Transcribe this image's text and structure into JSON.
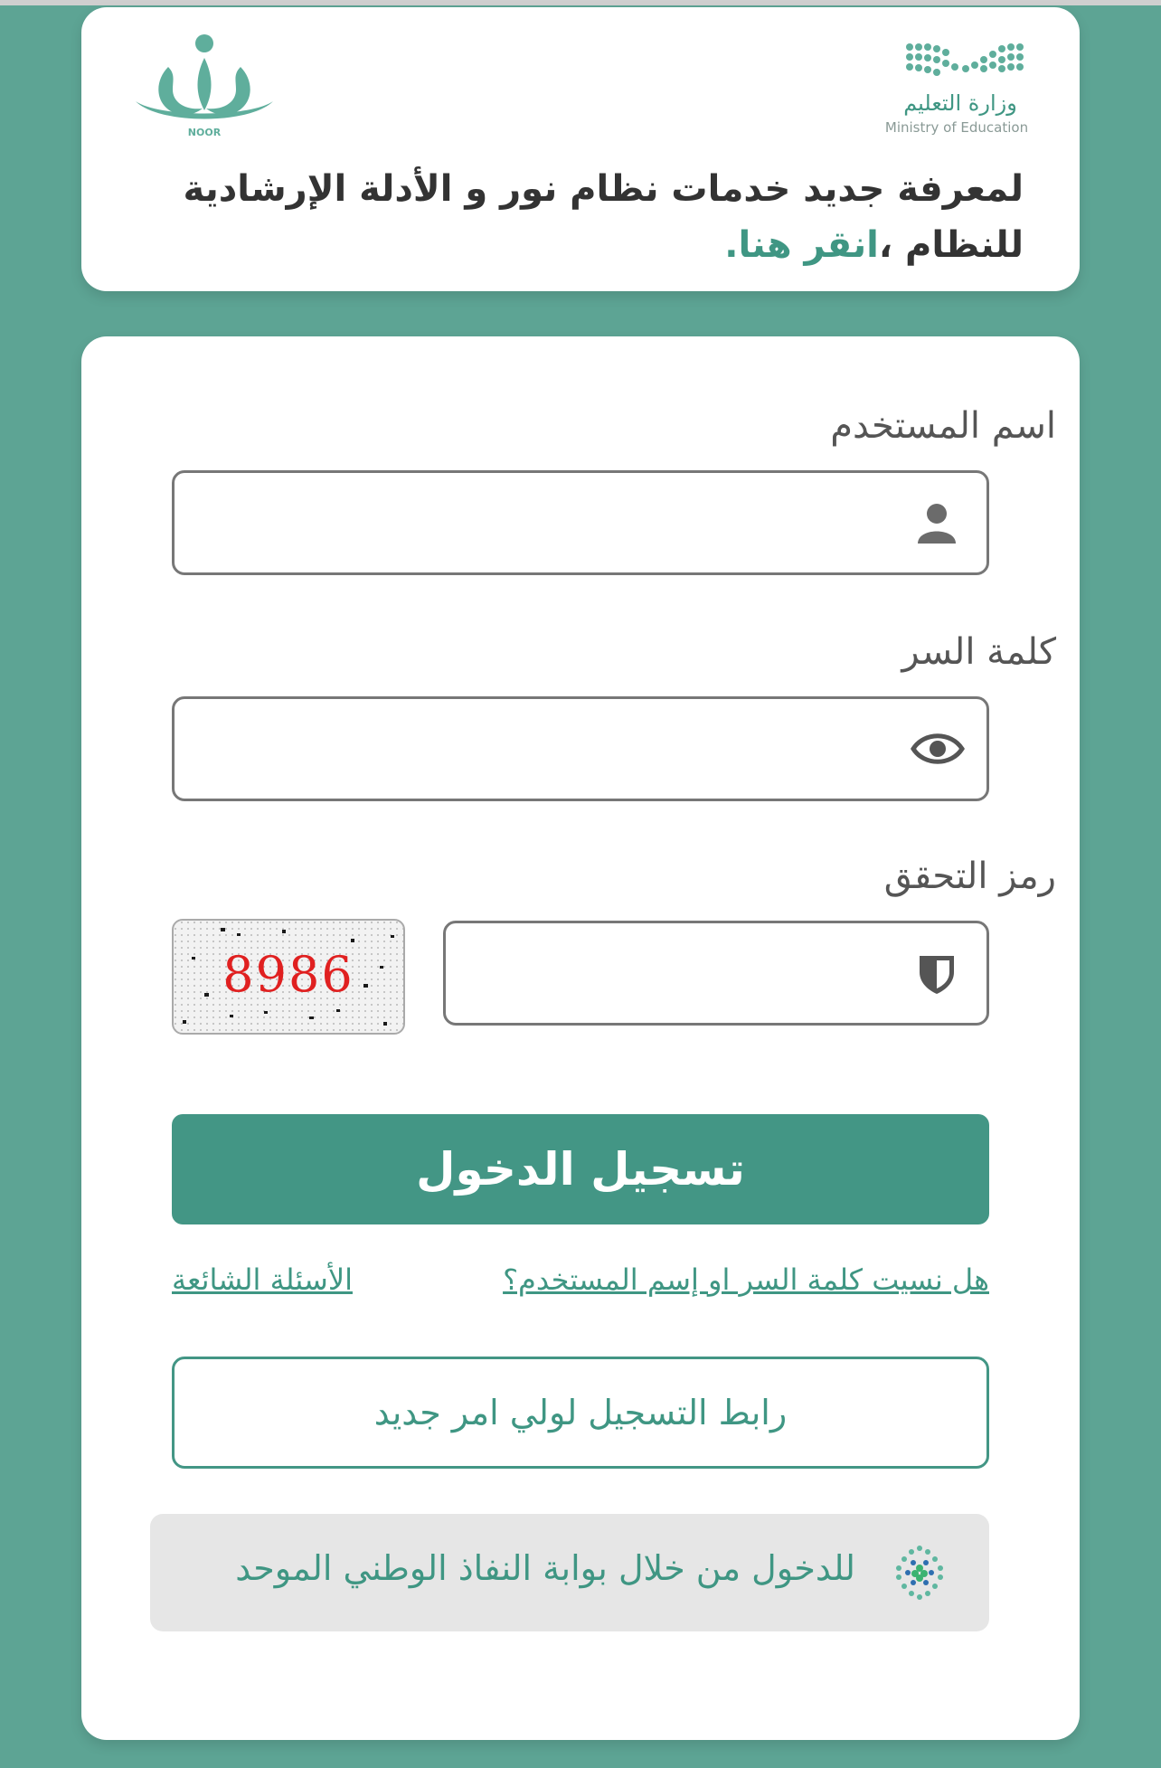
{
  "header": {
    "info_text": "لمعرفة جديد خدمات نظام نور و الأدلة الإرشادية للنظام ،",
    "info_link": "انقر هنا."
  },
  "logos": {
    "noor_label": "NOOR",
    "ministry_ar": "وزارة التعليم",
    "ministry_en": "Ministry of Education"
  },
  "form": {
    "username_label": "اسم المستخدم",
    "username_value": "",
    "password_label": "كلمة السر",
    "password_value": "",
    "captcha_label": "رمز التحقق",
    "captcha_value": "",
    "captcha_code": "8986",
    "login_button": "تسجيل الدخول",
    "forgot_link": "هل نسيت كلمة السر او إسم المستخدم؟",
    "faq_link": "الأسئلة الشائعة",
    "register_button": "رابط التسجيل لولي امر جديد",
    "nafath_button": "للدخول من خلال بوابة النفاذ الوطني الموحد"
  },
  "colors": {
    "background": "#5da494",
    "accent": "#439685",
    "link": "#3f9683",
    "captcha_text": "#e02020"
  },
  "icons": {
    "username": "user-icon",
    "password": "eye-icon",
    "captcha": "shield-icon",
    "nafath": "nafath-logo-icon"
  }
}
